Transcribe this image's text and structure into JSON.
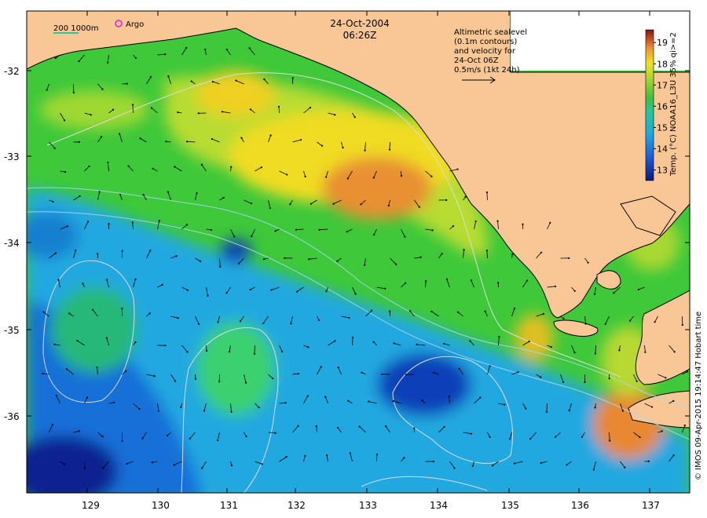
{
  "header": {
    "date": "24-Oct-2004",
    "time": "06:26Z"
  },
  "scale_bar": {
    "label": "200  1000m"
  },
  "argo_legend": {
    "label": "Argo"
  },
  "altimetry_note": {
    "lines": [
      "Altimetric sealevel",
      "(0.1m contours)",
      "and velocity for",
      "24-Oct 06Z",
      "0.5m/s (1kt 24h)"
    ]
  },
  "colorbar": {
    "label": "Temp. (°C) NOAA16_L3U 35% qi>=2",
    "ticks": [
      "13",
      "14",
      "15",
      "16",
      "17",
      "18",
      "19"
    ],
    "min": 12.5,
    "max": 19.6
  },
  "axes": {
    "x_ticks": [
      "129",
      "130",
      "131",
      "132",
      "133",
      "134",
      "135",
      "136",
      "137"
    ],
    "y_ticks": [
      "-32",
      "-33",
      "-34",
      "-35",
      "-36"
    ],
    "lon_range": [
      128.2,
      137.6
    ],
    "lat_range": [
      -36.85,
      -31.3
    ]
  },
  "credit": "© IMOS 09-Apr-2015 19:14:47 Hobart time",
  "colors": {
    "land": "#f9c796",
    "coast": "#000000",
    "contour": "#dcdcdc",
    "bathy": "#a8d8f0",
    "arrow": "#000000",
    "argo": "#e020e0"
  }
}
